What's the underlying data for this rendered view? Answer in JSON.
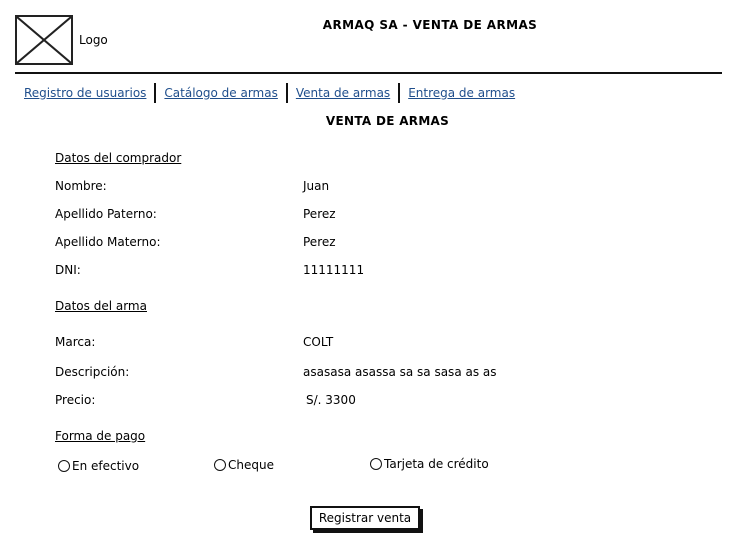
{
  "header": {
    "logo_label": "Logo",
    "title": "ARMAQ SA - VENTA DE ARMAS"
  },
  "nav": {
    "items": [
      {
        "label": "Registro de usuarios"
      },
      {
        "label": "Catálogo de armas"
      },
      {
        "label": "Venta de armas"
      },
      {
        "label": "Entrega de armas"
      }
    ]
  },
  "page_title": "VENTA DE ARMAS",
  "buyer": {
    "heading": "Datos del comprador",
    "fields": [
      {
        "label": "Nombre:",
        "value": "Juan"
      },
      {
        "label": "Apellido Paterno:",
        "value": "Perez"
      },
      {
        "label": "Apellido Materno:",
        "value": "Perez"
      },
      {
        "label": "DNI:",
        "value": "11111111"
      }
    ]
  },
  "weapon": {
    "heading": "Datos del arma",
    "fields": [
      {
        "label": "Marca:",
        "value": "COLT"
      },
      {
        "label": "Descripción:",
        "value": "asasasa asassa sa sa sasa as as"
      },
      {
        "label": "Precio:",
        "value": "S/. 3300"
      }
    ]
  },
  "payment": {
    "heading": "Forma de pago",
    "options": [
      {
        "label": "En efectivo"
      },
      {
        "label": "Cheque"
      },
      {
        "label": "Tarjeta de crédito"
      }
    ]
  },
  "submit_label": "Registrar venta",
  "icons": {
    "logo": "image-placeholder-icon",
    "radio": "radio-unchecked-icon"
  }
}
